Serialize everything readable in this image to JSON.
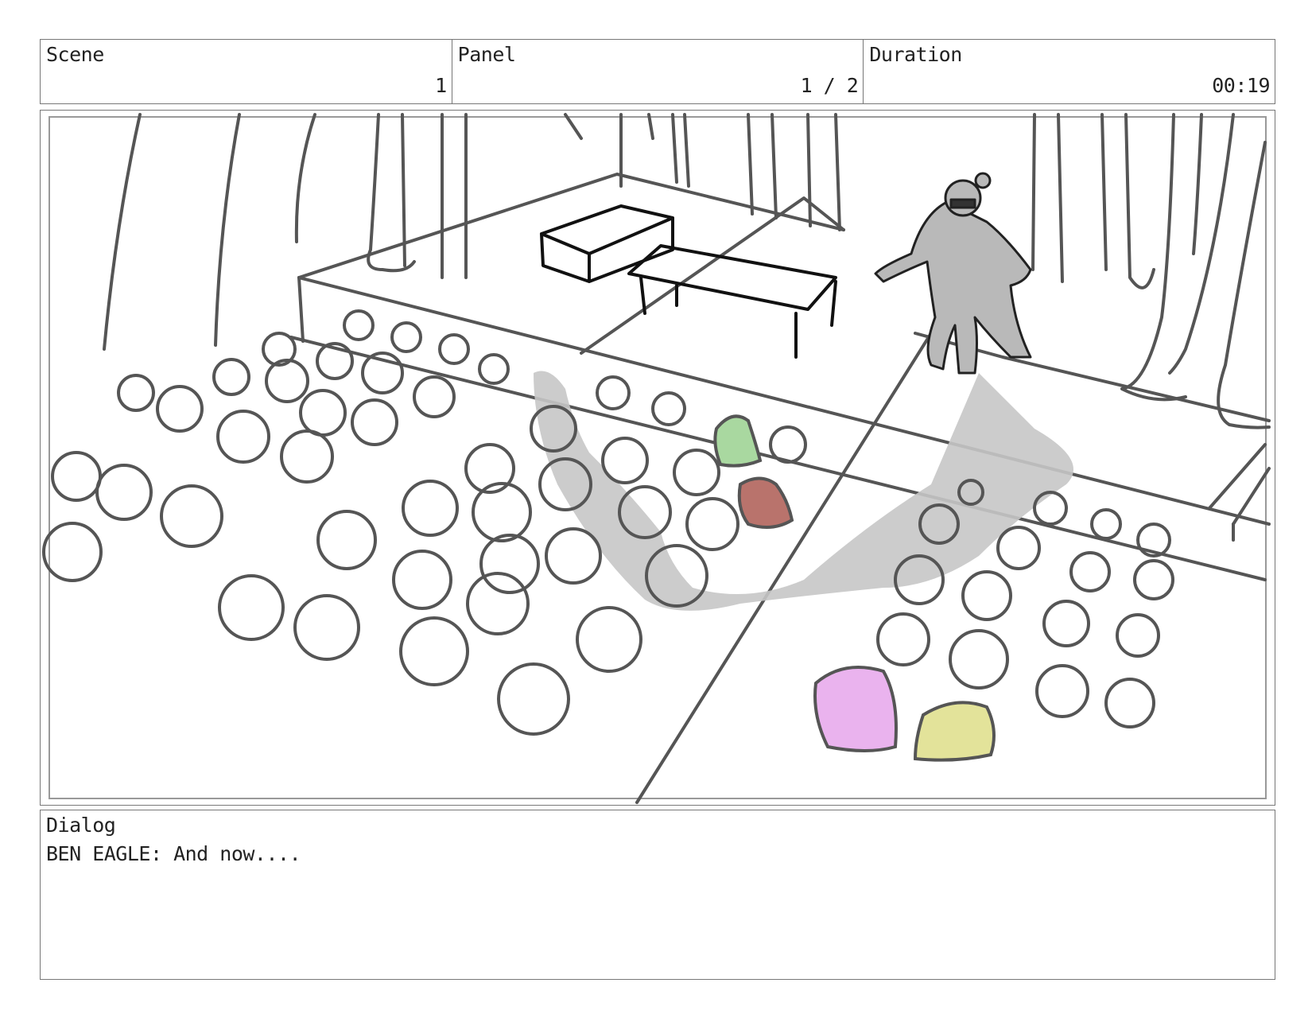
{
  "header": {
    "scene": {
      "label": "Scene",
      "value": "1"
    },
    "panel": {
      "label": "Panel",
      "value": "1 / 2"
    },
    "duration": {
      "label": "Duration",
      "value": "00:19"
    }
  },
  "artwork": {
    "description_icon": "storyboard-sketch",
    "colors": {
      "line": "#555555",
      "ink": "#111111",
      "shadow": "#c6c6c6",
      "figure": "#b9b9b9",
      "green": "#a9d8a0",
      "red": "#b9736c",
      "pink": "#eab3ee",
      "yellow": "#e3e39a"
    }
  },
  "dialog": {
    "label": "Dialog",
    "text": "BEN EAGLE: And now...."
  }
}
